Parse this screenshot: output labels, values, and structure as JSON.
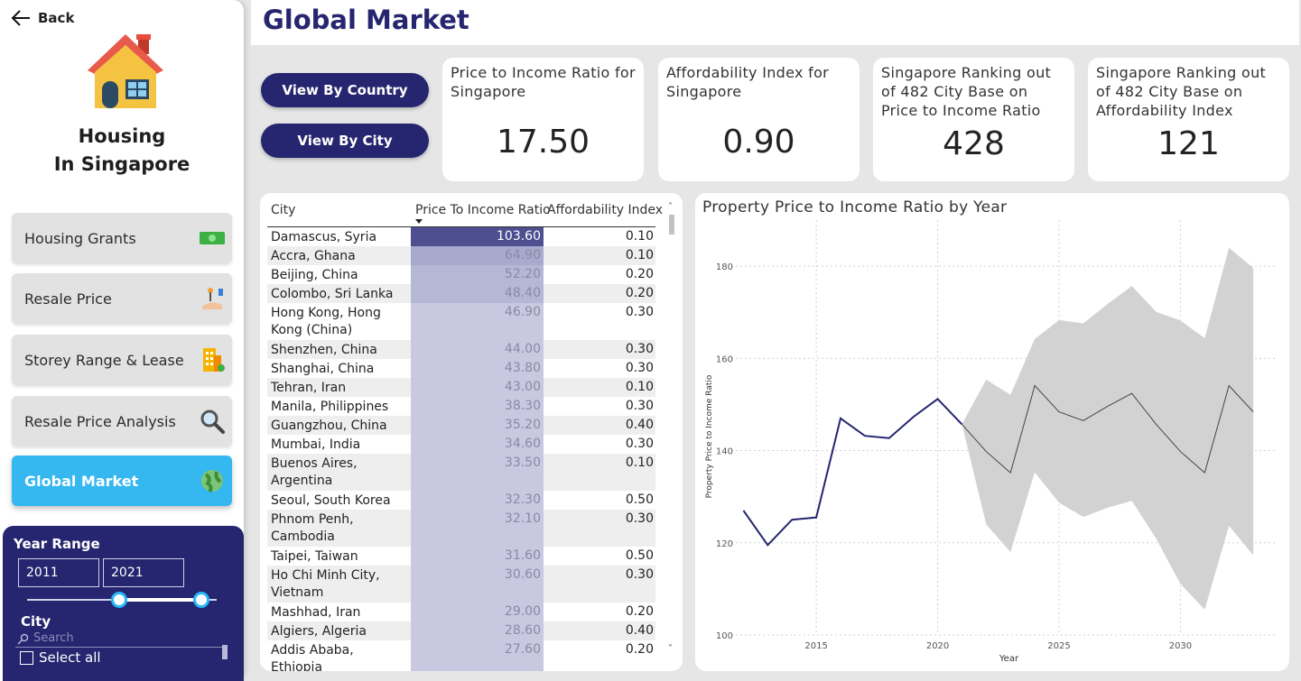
{
  "nav": {
    "back_label": "Back",
    "brand_line1": "Housing",
    "brand_line2": "In Singapore",
    "items": [
      {
        "label": "Housing Grants",
        "icon": "money-icon"
      },
      {
        "label": "Resale Price",
        "icon": "hand-key-icon"
      },
      {
        "label": "Storey Range & Lease",
        "icon": "building-icon"
      },
      {
        "label": "Resale Price Analysis",
        "icon": "magnifier-icon"
      },
      {
        "label": "Global Market",
        "icon": "globe-icon",
        "active": true
      }
    ]
  },
  "filters": {
    "year_range_label": "Year Range",
    "year_from": "2011",
    "year_to": "2021",
    "city_label": "City",
    "search_placeholder": "Search",
    "select_all_label": "Select all"
  },
  "header": {
    "title": "Global Market"
  },
  "toggle": {
    "by_country": "View By Country",
    "by_city": "View By City"
  },
  "kpis": [
    {
      "title": "Price to Income Ratio for Singapore",
      "value": "17.50"
    },
    {
      "title": "Affordability Index for Singapore",
      "value": "0.90"
    },
    {
      "title": "Singapore Ranking out of 482 City Base on Price to Income Ratio",
      "value": "428"
    },
    {
      "title": "Singapore Ranking out of 482 City Base on Affordability Index",
      "value": "121"
    }
  ],
  "table": {
    "columns": [
      "City",
      "Price To Income Ratio",
      "Affordability Index"
    ],
    "rows": [
      {
        "city": "Damascus, Syria",
        "pi": "103.60",
        "ai": "0.10"
      },
      {
        "city": "Accra, Ghana",
        "pi": "64.90",
        "ai": "0.10"
      },
      {
        "city": "Beijing, China",
        "pi": "52.20",
        "ai": "0.20"
      },
      {
        "city": "Colombo, Sri Lanka",
        "pi": "48.40",
        "ai": "0.20"
      },
      {
        "city": "Hong Kong, Hong Kong (China)",
        "pi": "46.90",
        "ai": "0.30"
      },
      {
        "city": "Shenzhen, China",
        "pi": "44.00",
        "ai": "0.30"
      },
      {
        "city": "Shanghai, China",
        "pi": "43.80",
        "ai": "0.30"
      },
      {
        "city": "Tehran, Iran",
        "pi": "43.00",
        "ai": "0.10"
      },
      {
        "city": "Manila, Philippines",
        "pi": "38.30",
        "ai": "0.30"
      },
      {
        "city": "Guangzhou, China",
        "pi": "35.20",
        "ai": "0.40"
      },
      {
        "city": "Mumbai, India",
        "pi": "34.60",
        "ai": "0.30"
      },
      {
        "city": "Buenos Aires, Argentina",
        "pi": "33.50",
        "ai": "0.10"
      },
      {
        "city": "Seoul, South Korea",
        "pi": "32.30",
        "ai": "0.50"
      },
      {
        "city": "Phnom Penh, Cambodia",
        "pi": "32.10",
        "ai": "0.30"
      },
      {
        "city": "Taipei, Taiwan",
        "pi": "31.60",
        "ai": "0.50"
      },
      {
        "city": "Ho Chi Minh City, Vietnam",
        "pi": "30.60",
        "ai": "0.30"
      },
      {
        "city": "Mashhad, Iran",
        "pi": "29.00",
        "ai": "0.20"
      },
      {
        "city": "Algiers, Algeria",
        "pi": "28.60",
        "ai": "0.40"
      },
      {
        "city": "Addis Ababa, Ethiopia",
        "pi": "27.60",
        "ai": "0.20"
      }
    ]
  },
  "chart_data": {
    "type": "line",
    "title": "Property Price to Income Ratio by Year",
    "xlabel": "Year",
    "ylabel": "Property Price to Income Ratio",
    "xlim": [
      2011.5,
      2034
    ],
    "ylim": [
      100,
      190
    ],
    "x_ticks": [
      2015,
      2020,
      2025,
      2030
    ],
    "y_ticks": [
      100,
      120,
      140,
      160,
      180
    ],
    "grid": true,
    "colors": {
      "actual": "#25266f",
      "forecast": "#444444",
      "band": "#d2d2d2"
    },
    "series": [
      {
        "x": [
          2012,
          2013,
          2014,
          2015,
          2016,
          2017,
          2018,
          2019,
          2020,
          2021
        ],
        "values": [
          127,
          119.5,
          125,
          125.5,
          147,
          143.2,
          142.7,
          147.3,
          151.2,
          145.7
        ]
      },
      {
        "x": [
          2021,
          2022,
          2023,
          2024,
          2025,
          2026,
          2027,
          2028,
          2029,
          2030,
          2031,
          2032,
          2033
        ],
        "values": [
          145.7,
          139.8,
          135.2,
          154.1,
          148.4,
          146.5,
          149.6,
          152.4,
          145.7,
          139.8,
          135.2,
          154.1,
          148.4
        ],
        "upper": [
          145.7,
          155.4,
          152.1,
          164.2,
          168.3,
          167.6,
          171.8,
          175.7,
          170.1,
          168.2,
          164.4,
          184.0,
          179.6
        ],
        "lower": [
          145.7,
          124.0,
          118.0,
          135.3,
          128.7,
          125.6,
          127.6,
          129.1,
          120.9,
          111.1,
          105.5,
          123.7,
          117.3
        ]
      }
    ]
  }
}
